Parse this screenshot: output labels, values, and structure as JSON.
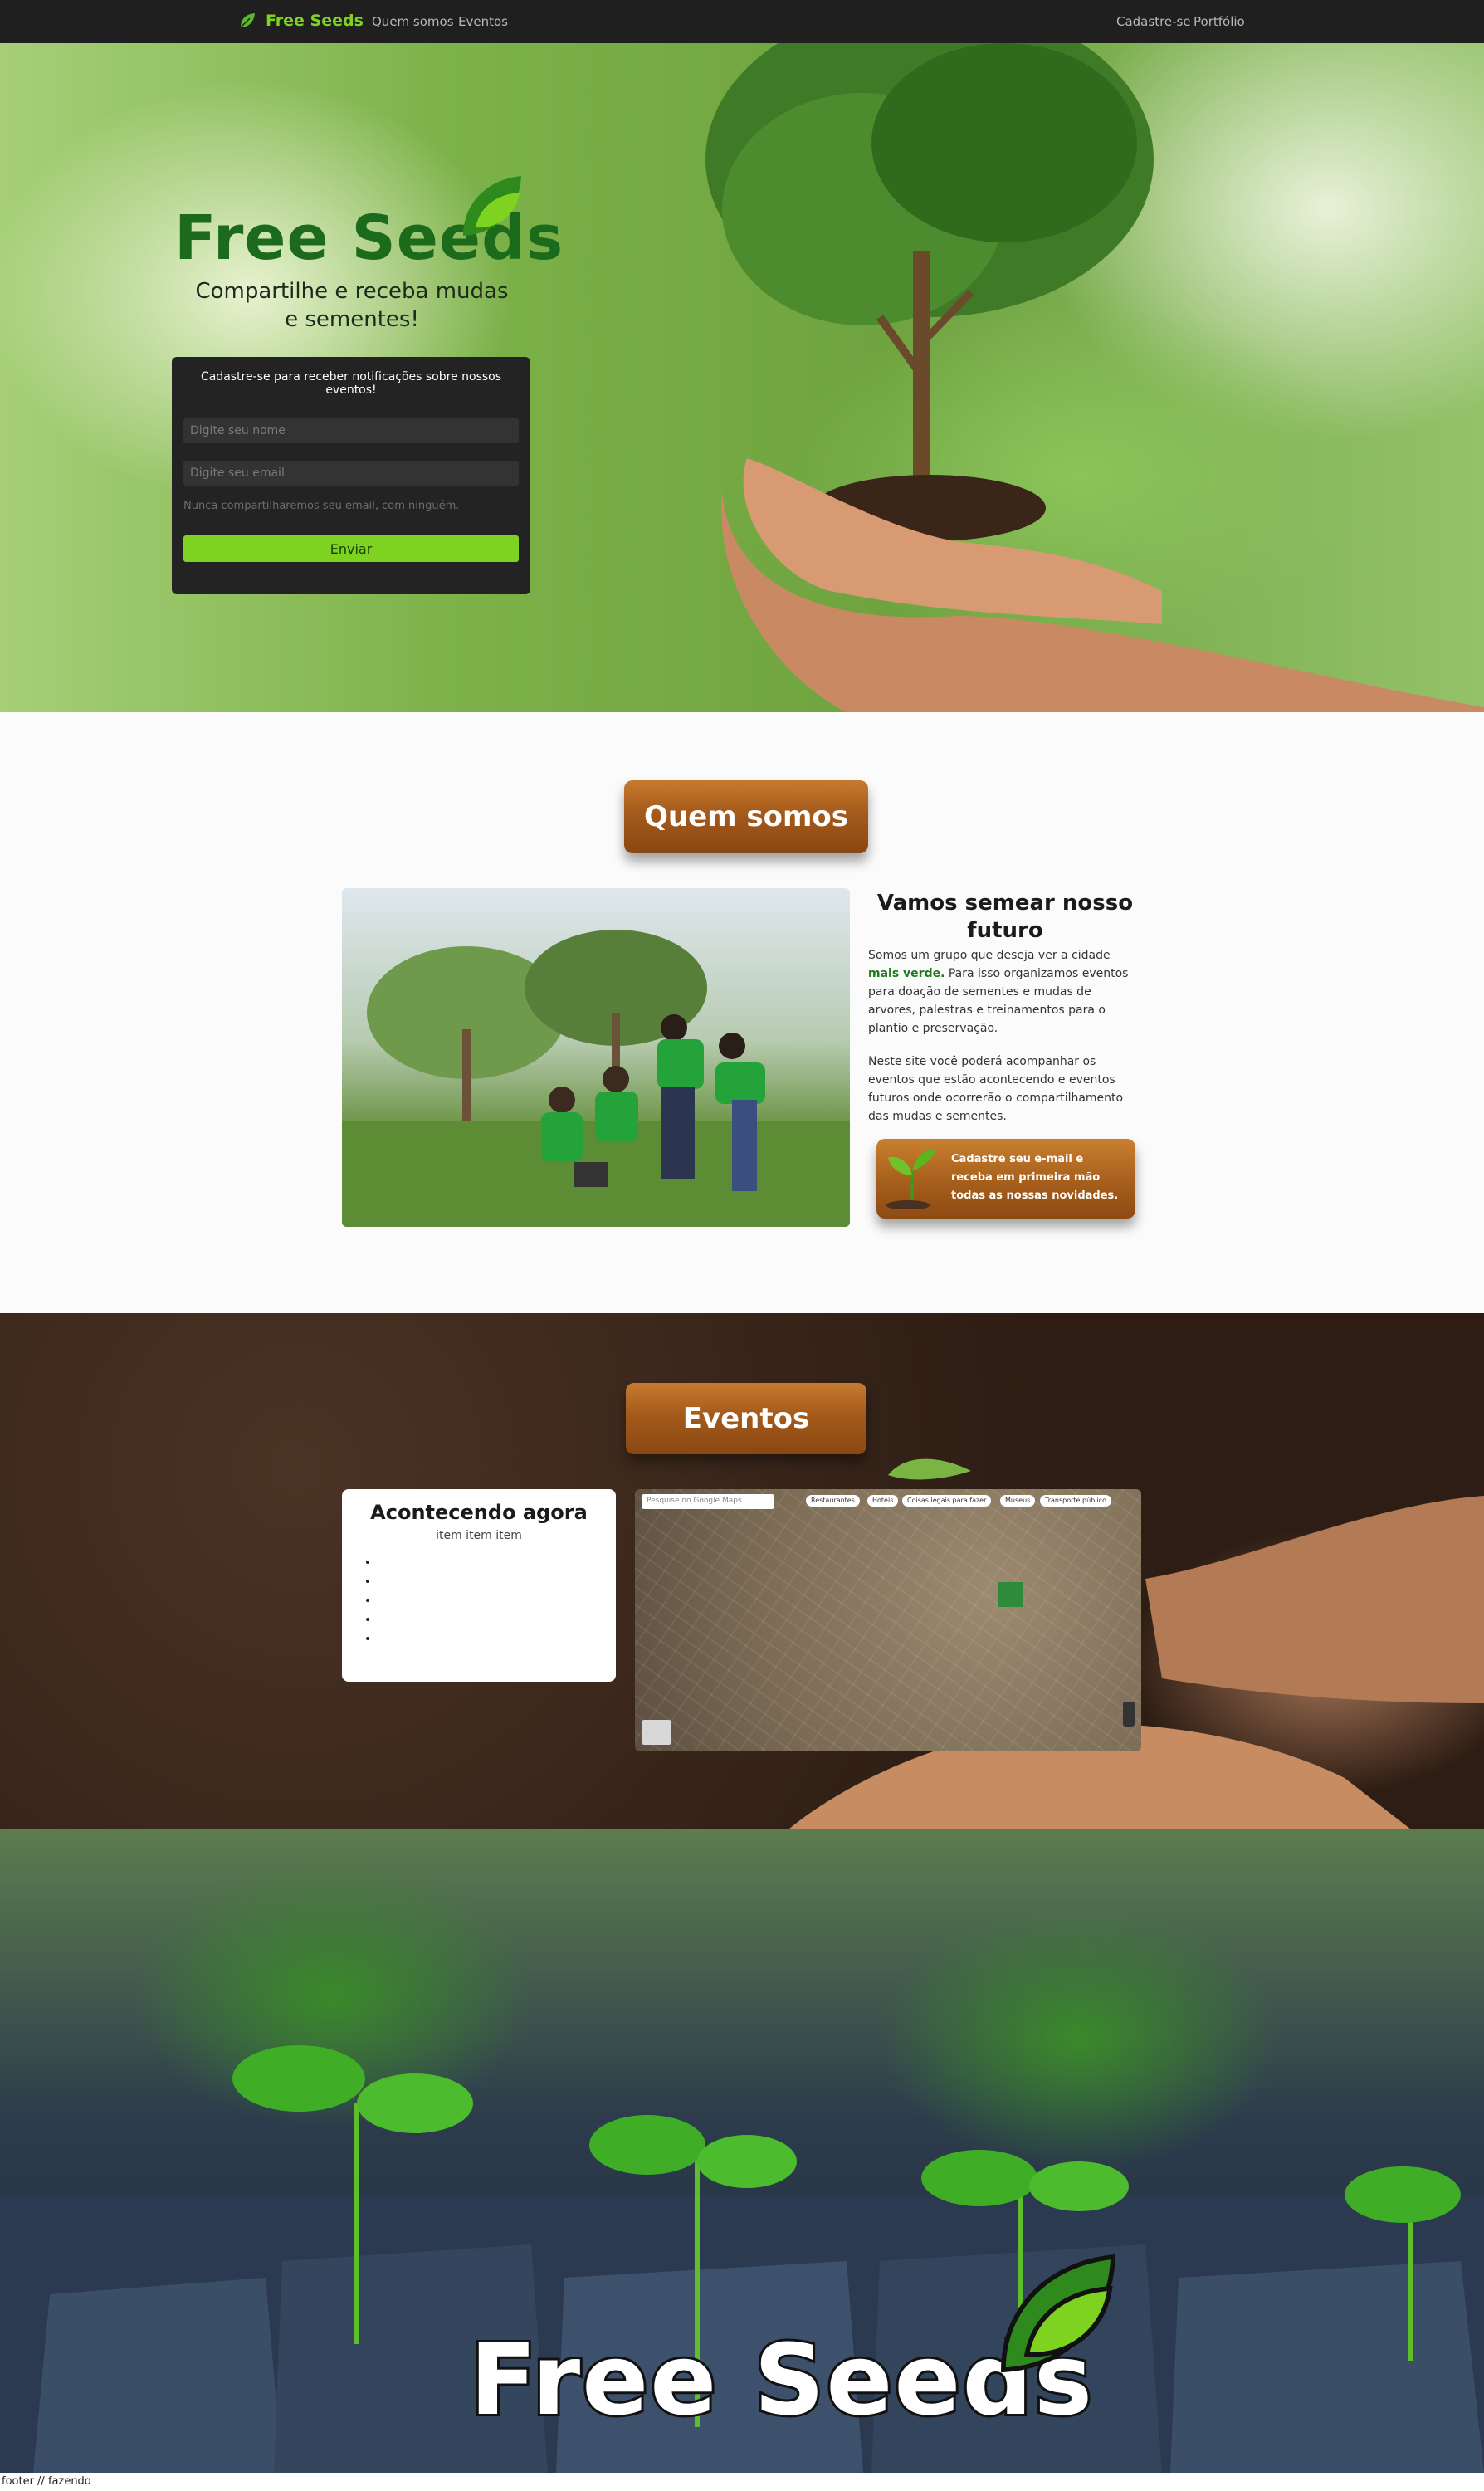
{
  "colors": {
    "accent": "#7ed321",
    "brand_green": "#1c6b1c",
    "navbar_bg": "#1f1f1f",
    "wood": "#a45a1b"
  },
  "nav": {
    "brand": "Free Seeds",
    "links": [
      "Quem somos",
      "Eventos"
    ],
    "right_links": [
      "Cadastre-se",
      "Portfólio"
    ]
  },
  "hero": {
    "logo": "Free Seeds",
    "subtitle": "Compartilhe e receba mudas e sementes!",
    "form": {
      "title": "Cadastre-se para receber notificações sobre nossos eventos!",
      "name_placeholder": "Digite seu nome",
      "email_placeholder": "Digite seu email",
      "help": "Nunca compartilharemos seu email, com ninguém.",
      "submit": "Enviar"
    }
  },
  "about": {
    "sign": "Quem somos",
    "heading": "Vamos semear nosso futuro",
    "p1_before": "Somos um grupo que deseja ver a cidade ",
    "p1_bold": "mais verde.",
    "p1_after": " Para isso organizamos eventos para doação de sementes e mudas de arvores, palestras e treinamentos para o plantio e preservação.",
    "p2": "Neste site você poderá acompanhar os eventos que estão acontecendo e eventos futuros onde ocorrerão o compartilhamento das mudas e sementes.",
    "cta": "Cadastre seu e-mail e receba em primeira mão todas as nossas novidades."
  },
  "events": {
    "sign": "Eventos",
    "card_title": "Acontecendo agora",
    "card_subtitle": "item item item",
    "list_items": [
      "",
      "",
      "",
      "",
      ""
    ],
    "map": {
      "search_placeholder": "Pesquise no Google Maps",
      "chips": [
        "Restaurantes",
        "Hotéis",
        "Coisas legais para fazer",
        "Museus",
        "Transporte público"
      ]
    }
  },
  "banner": {
    "logo": "Free Seeds"
  },
  "footer": {
    "text": "footer // fazendo"
  }
}
